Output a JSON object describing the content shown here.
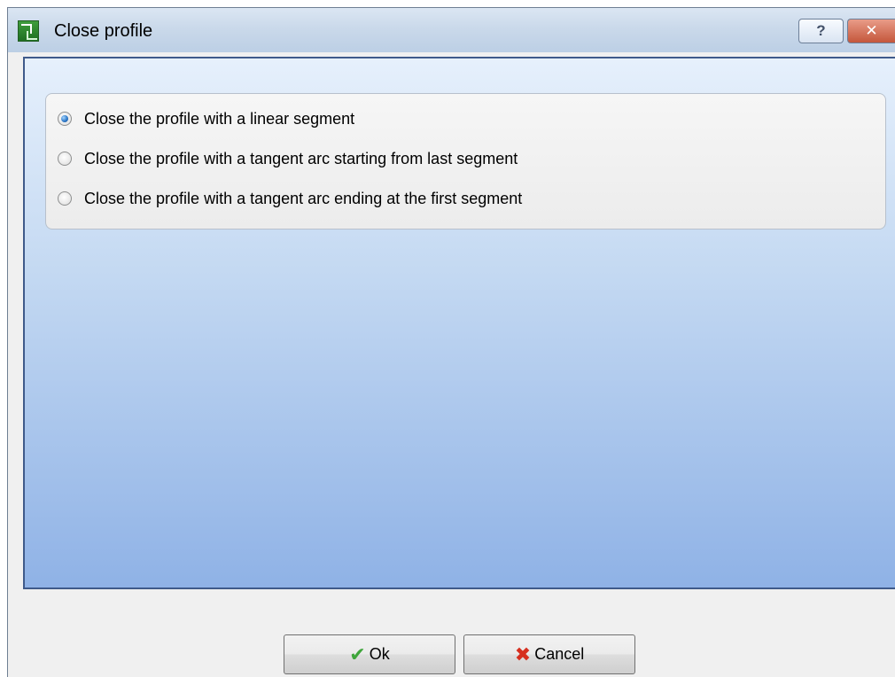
{
  "window": {
    "title": "Close profile",
    "help_label": "?",
    "close_label": "✕"
  },
  "options": [
    {
      "label": "Close the profile with a linear segment",
      "checked": true
    },
    {
      "label": "Close the profile with a tangent arc starting from last segment",
      "checked": false
    },
    {
      "label": "Close the profile with a tangent arc ending at the first segment",
      "checked": false
    }
  ],
  "buttons": {
    "ok_label": "Ok",
    "cancel_label": "Cancel",
    "ok_icon": "check-icon",
    "cancel_icon": "x-icon"
  },
  "colors": {
    "title_bar": "#c7d8ec",
    "content_top": "#e6f0fc",
    "content_bottom": "#8fb2e6",
    "border": "#3f5a8a"
  }
}
